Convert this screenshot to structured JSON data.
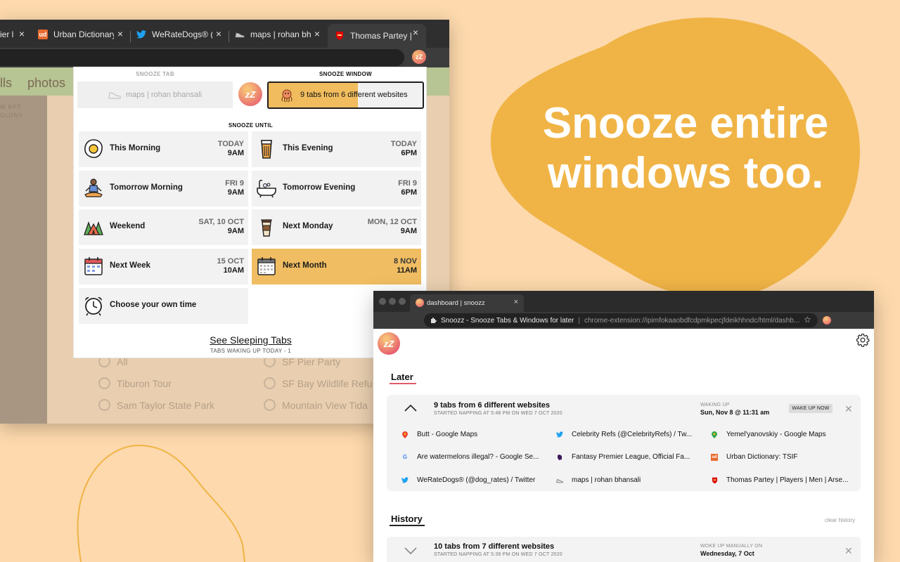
{
  "back_window": {
    "tabs": [
      {
        "title": "ier l",
        "icon": "generic-icon"
      },
      {
        "title": "Urban Dictionary",
        "icon": "urban-dictionary-icon"
      },
      {
        "title": "WeRateDogs® (@",
        "icon": "twitter-icon"
      },
      {
        "title": "maps | rohan bha",
        "icon": "shoe-icon"
      },
      {
        "title": "Thomas Partey |",
        "icon": "arsenal-icon"
      }
    ],
    "page": {
      "nav_items": [
        "lls",
        "photos"
      ],
      "map_labels": [
        "W BPT",
        "OLONY"
      ],
      "options": [
        "All",
        "SF Pier Party",
        "Tiburon Tour",
        "SF Bay Wildlife Refu",
        "Sam Taylor State Park",
        "Mountain View Tida"
      ]
    }
  },
  "popup": {
    "snooze_tab_heading": "SNOOZE TAB",
    "snooze_window_heading": "SNOOZE WINDOW",
    "snooze_tab_label": "maps | rohan bhansali",
    "snooze_window_label": "9 tabs from 6 different websites",
    "snooze_window_progress": 0.58,
    "logo_text": "zZ",
    "snooze_until_heading": "SNOOZE UNTIL",
    "options": [
      {
        "label": "This Morning",
        "day": "TODAY",
        "time": "9AM",
        "icon": "egg-icon"
      },
      {
        "label": "This Evening",
        "day": "TODAY",
        "time": "6PM",
        "icon": "beer-icon"
      },
      {
        "label": "Tomorrow Morning",
        "day": "FRI 9",
        "time": "9AM",
        "icon": "meditation-icon"
      },
      {
        "label": "Tomorrow Evening",
        "day": "FRI 9",
        "time": "6PM",
        "icon": "bathtub-icon"
      },
      {
        "label": "Weekend",
        "day": "SAT, 10 OCT",
        "time": "9AM",
        "icon": "camping-tent-icon"
      },
      {
        "label": "Next Monday",
        "day": "MON, 12 OCT",
        "time": "9AM",
        "icon": "coffee-cup-icon"
      },
      {
        "label": "Next Week",
        "day": "15 OCT",
        "time": "10AM",
        "icon": "calendar-icon"
      },
      {
        "label": "Next Month",
        "day": "8 NOV",
        "time": "11AM",
        "icon": "calendar-grid-icon"
      },
      {
        "label": "Choose your own time",
        "day": "",
        "time": "",
        "icon": "alarm-clock-icon"
      }
    ],
    "see_sleeping": "See Sleeping Tabs",
    "waking_today": "TABS WAKING UP TODAY - 1"
  },
  "headline": {
    "line1": "Snooze entire",
    "line2": "windows too."
  },
  "dashboard": {
    "tab_title": "dashboard | snoozz",
    "omnibox_title": "Snoozz - Snooze Tabs & Windows for later",
    "omnibox_url": "chrome-extension://ipimfokaaobdfcdpmkpecjfdeikhhndc/html/dashb...",
    "later_heading": "Later",
    "history_heading": "History",
    "clear_history": "clear history",
    "later_card": {
      "title": "9 tabs from 6 different websites",
      "subtitle": "STARTED NAPPING AT 5:48 PM ON WED 7 OCT 2020",
      "wake_label": "WAKING UP",
      "wake_time": "Sun, Nov 8 @ 11:31 am",
      "wake_button": "WAKE UP NOW",
      "close": "✕",
      "links": [
        {
          "title": "Butt - Google Maps",
          "icon": "google-maps-icon"
        },
        {
          "title": "Celebrity Refs (@CelebrityRefs) / Tw...",
          "icon": "twitter-icon"
        },
        {
          "title": "Yemel'yanovskiy - Google Maps",
          "icon": "google-maps-icon"
        },
        {
          "title": "Are watermelons illegal? - Google Se...",
          "icon": "google-icon"
        },
        {
          "title": "Fantasy Premier League, Official Fa...",
          "icon": "premier-league-icon"
        },
        {
          "title": "Urban Dictionary: TSIF",
          "icon": "urban-dictionary-icon"
        },
        {
          "title": "WeRateDogs® (@dog_rates) / Twitter",
          "icon": "twitter-icon"
        },
        {
          "title": "maps | rohan bhansali",
          "icon": "shoe-icon"
        },
        {
          "title": "Thomas Partey | Players | Men | Arse...",
          "icon": "arsenal-icon"
        }
      ]
    },
    "history_card": {
      "title": "10 tabs from 7 different websites",
      "subtitle": "STARTED NAPPING AT 5:39 PM ON WED 7 OCT 2020",
      "wake_label": "WOKE UP MANUALLY ON",
      "wake_time": "Wednesday, 7 Oct",
      "close": "✕"
    }
  },
  "colors": {
    "background": "#fdd9ad",
    "accent": "#f0bc5e",
    "logo_red": "#e75a6f",
    "underline": "#e05a6a"
  }
}
